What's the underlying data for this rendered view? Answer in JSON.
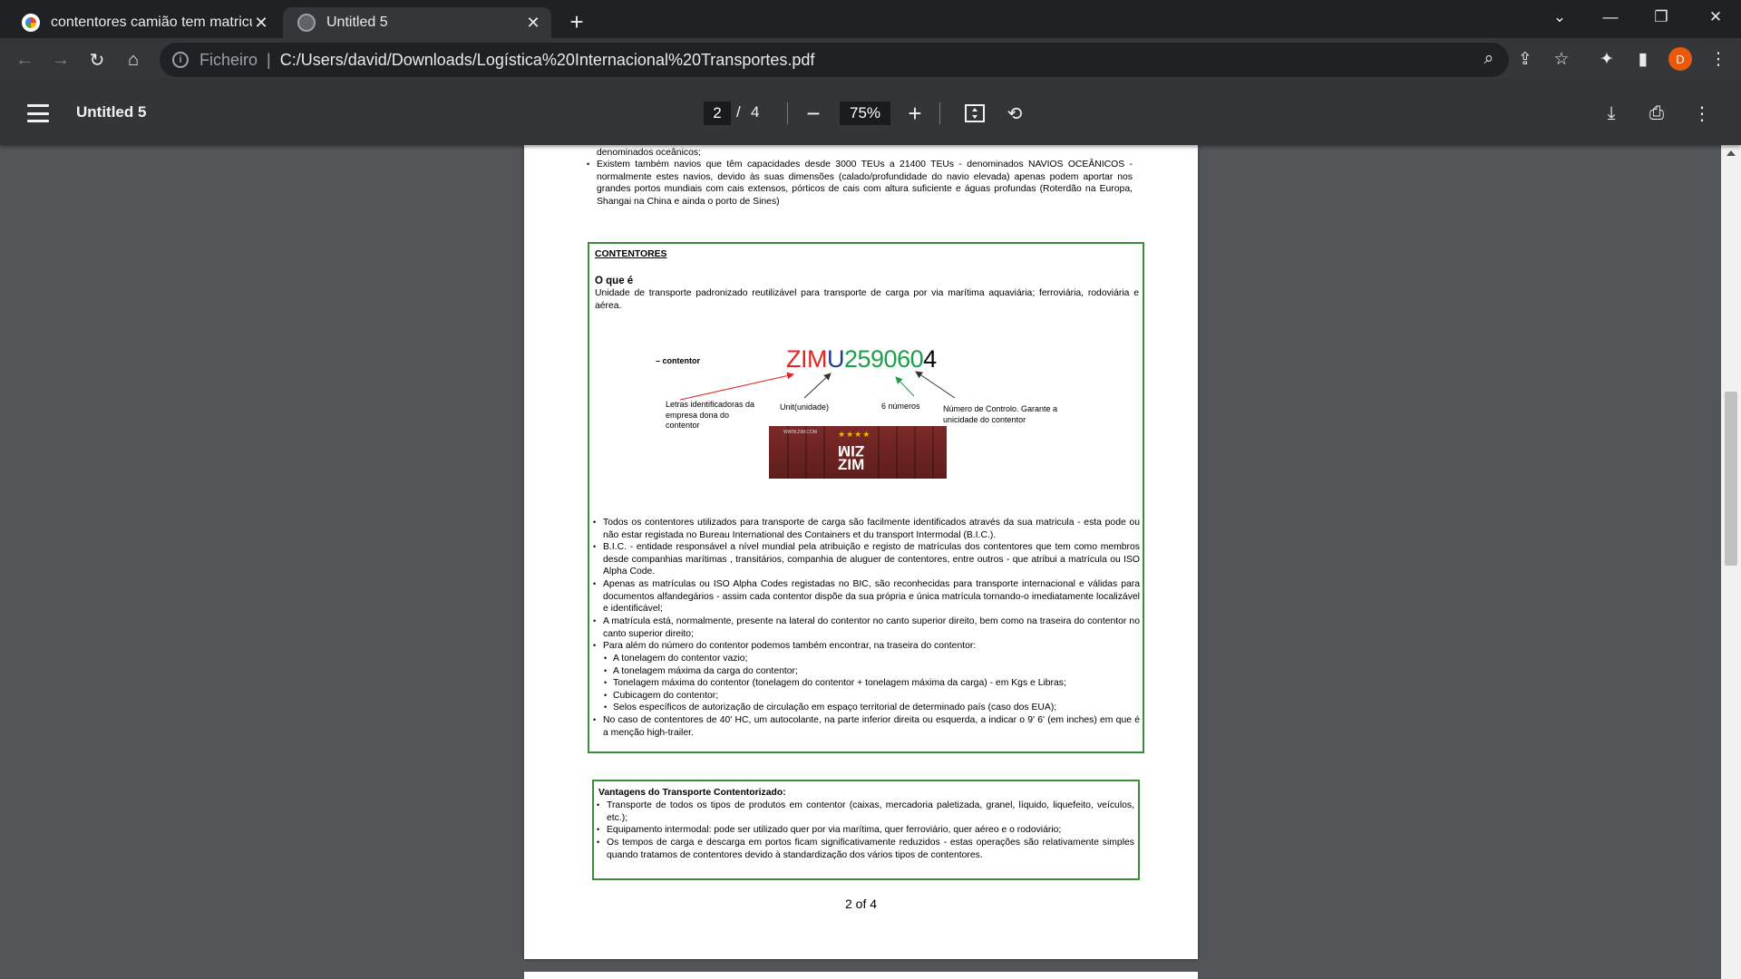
{
  "browser": {
    "tabs": [
      {
        "title": "contentores camião tem matricula",
        "icon": "google-icon",
        "active": false
      },
      {
        "title": "Untitled 5",
        "icon": "globe-icon",
        "active": true
      }
    ],
    "address": {
      "scheme_label": "Ficheiro",
      "url": "C:/Users/david/Downloads/Logística%20Internacional%20Transportes.pdf"
    },
    "profile_initial": "D"
  },
  "pdf_viewer": {
    "title": "Untitled 5",
    "current_page": "2",
    "page_separator": "/",
    "total_pages": "4",
    "zoom": "75%"
  },
  "document": {
    "top_lines": {
      "line0": "denominados oceânicos;",
      "bullet": "Existem também navios que têm capacidades desde 3000 TEUs a 21400 TEUs - denominados NAVIOS OCEÂNICOS - normalmente estes navios, devido às suas dimensões (calado/profundidade do navio elevada) apenas podem aportar nos grandes portos mundiais com cais extensos, pórticos de cais com altura suficiente e águas profundas (Roterdão na Europa, Shangai na China e ainda o porto de Sines)"
    },
    "containers_box": {
      "heading": "CONTENTORES",
      "subheading": "O que é",
      "definition": "Unidade de transporte padronizado reutilizável para transporte de carga por via marítima aquaviária; ferroviária, rodoviária e aérea.",
      "figure": {
        "caption": "– contentor",
        "code_owner": "ZIM",
        "code_unit": "U",
        "code_numbers": "259060",
        "code_check": "4",
        "label_owner": "Letras identificadoras da empresa dona do contentor",
        "label_unit": "Unit(unidade)",
        "label_numbers": "6 números",
        "label_check": "Número de Controlo. Garante a unicidade do contentor",
        "container_logo": "ZIM",
        "container_url": "WWW.ZIM.COM"
      },
      "bullets": [
        "Todos os contentores utilizados para transporte de carga são facilmente identificados através da sua matricula - esta pode ou não estar registada no Bureau International des Containers et du transport Intermodal (B.I.C.).",
        "B.I.C. - entidade responsável a nível mundial pela atribuição e registo de matrículas dos contentores que tem como membros desde companhias marítimas , transitários, companhia de aluguer de contentores, entre outros - que atribui a matrícula ou ISO Alpha Code.",
        "Apenas as matrículas ou ISO Alpha Codes registadas no BIC, são reconhecidas para transporte internacional e válidas para documentos alfandegários - assim cada contentor dispõe da sua própria e única matrícula tornando-o imediatamente localizável e identificável;",
        "A matrícula está, normalmente, presente na lateral do contentor no canto superior direito, bem como na traseira do contentor no canto superior direito;",
        "Para além do número do contentor podemos também encontrar, na traseira do contentor:"
      ],
      "sub_bullets": [
        "A tonelagem do contentor vazio;",
        "A tonelagem máxima da carga do contentor;",
        "Tonelagem máxima do contentor (tonelagem do contentor + tonelagem máxima da carga) - em Kgs e Libras;",
        "Cubicagem do contentor;",
        "Selos específicos de autorização de circulação em espaço territorial de determinado país (caso dos EUA);"
      ],
      "last_bullet": "No caso de contentores de 40' HC, um autocolante, na parte inferior direita ou esquerda, a indicar o 9' 6' (em inches) em que é a menção high-trailer."
    },
    "advantages_box": {
      "heading": "Vantagens do Transporte Contentorizado:",
      "bullets": [
        "Transporte de todos os tipos de produtos em contentor (caixas, mercadoria paletizada, granel, líquido, liquefeito, veículos, etc.);",
        "Equipamento intermodal: pode ser utilizado quer por via marítima, quer ferroviário, quer aéreo e o rodoviário;",
        "Os tempos de carga e descarga em portos ficam significativamente reduzidos - estas operações são relativamente simples quando tratamos de contentores devido à standardização dos vários tipos de contentores."
      ]
    },
    "page_footer": "2 of 4"
  },
  "colors": {
    "code_owner": "#e52421",
    "code_unit": "#233a8e",
    "code_numbers": "#1aa04a",
    "code_check": "#000000",
    "box_border": "#3b8c3b"
  }
}
